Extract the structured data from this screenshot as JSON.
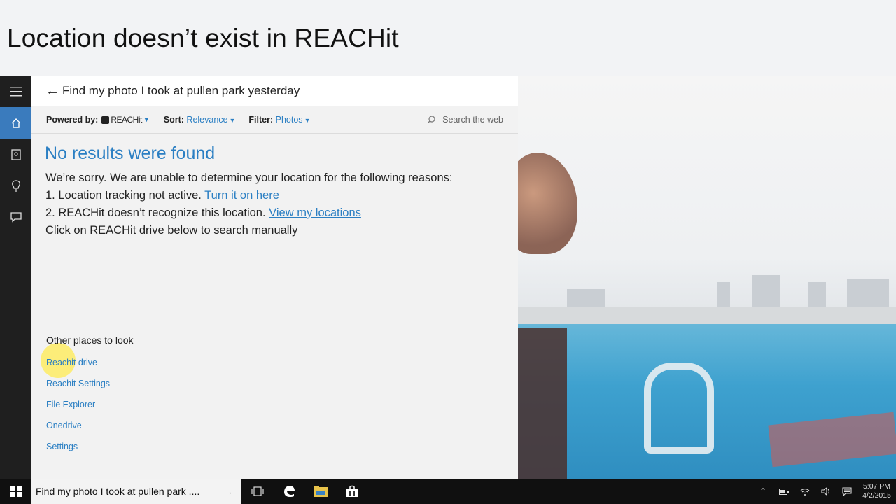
{
  "slide": {
    "title": "Location doesn’t exist in REACHit"
  },
  "header": {
    "query": "Find my photo I took at pullen park yesterday"
  },
  "toolbar": {
    "powered_label": "Powered by:",
    "powered_brand": "REACHit",
    "sort_label": "Sort:",
    "sort_value": "Relevance",
    "filter_label": "Filter:",
    "filter_value": "Photos",
    "search_web": "Search the web"
  },
  "results": {
    "heading": "No results were found",
    "sorry": "We’re sorry. We are unable to determine your location for the following reasons:",
    "reason1_text": "1. Location tracking not active. ",
    "reason1_link": "Turn it on here",
    "reason2_text": "2. REACHit doesn’t recognize this location. ",
    "reason2_link": "View my locations",
    "manual": "Click on REACHit drive below to search manually"
  },
  "other_places": {
    "title": "Other places to look",
    "links": [
      "Reachit drive",
      "Reachit Settings",
      "File Explorer",
      "Onedrive",
      "Settings"
    ]
  },
  "taskbar": {
    "search_text": "Find my photo I took at pullen park ....",
    "time": "5:07 PM",
    "date": "4/2/2015"
  },
  "colors": {
    "accent": "#2b7fc3",
    "rail": "#1f1f1f",
    "rail_active": "#3a7bbd",
    "taskbar": "#101010"
  }
}
